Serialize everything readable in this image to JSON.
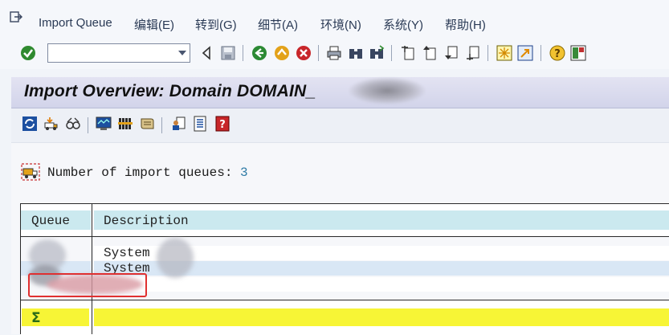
{
  "menubar": {
    "items": [
      {
        "label": "Import Queue"
      },
      {
        "label": "编辑(E)"
      },
      {
        "label": "转到(G)"
      },
      {
        "label": "细节(A)"
      },
      {
        "label": "环境(N)"
      },
      {
        "label": "系统(Y)"
      },
      {
        "label": "帮助(H)"
      }
    ]
  },
  "toolbar": {
    "command_field_value": ""
  },
  "title": {
    "text": "Import Overview: Domain DOMAIN_"
  },
  "summary": {
    "label": "Number of import queues:",
    "count": "3"
  },
  "table": {
    "columns": [
      "Queue",
      "Description"
    ],
    "rows": [
      {
        "queue": "",
        "description": "System"
      },
      {
        "queue": "",
        "description": "System"
      },
      {
        "queue": "",
        "description": ""
      }
    ]
  },
  "colors": {
    "header_cell": "#cbe9ef",
    "total_row": "#f7f536",
    "highlight_box": "#e03030",
    "count_text": "#2d7aa5"
  }
}
